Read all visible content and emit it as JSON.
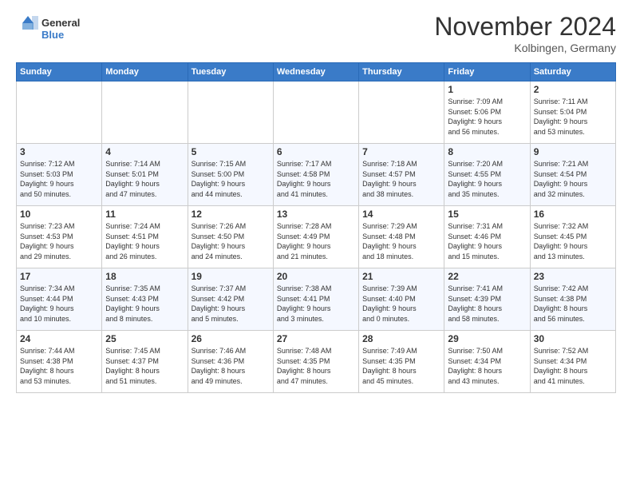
{
  "header": {
    "logo_general": "General",
    "logo_blue": "Blue",
    "month_title": "November 2024",
    "location": "Kolbingen, Germany"
  },
  "weekdays": [
    "Sunday",
    "Monday",
    "Tuesday",
    "Wednesday",
    "Thursday",
    "Friday",
    "Saturday"
  ],
  "weeks": [
    [
      {
        "day": "",
        "info": ""
      },
      {
        "day": "",
        "info": ""
      },
      {
        "day": "",
        "info": ""
      },
      {
        "day": "",
        "info": ""
      },
      {
        "day": "",
        "info": ""
      },
      {
        "day": "1",
        "info": "Sunrise: 7:09 AM\nSunset: 5:06 PM\nDaylight: 9 hours\nand 56 minutes."
      },
      {
        "day": "2",
        "info": "Sunrise: 7:11 AM\nSunset: 5:04 PM\nDaylight: 9 hours\nand 53 minutes."
      }
    ],
    [
      {
        "day": "3",
        "info": "Sunrise: 7:12 AM\nSunset: 5:03 PM\nDaylight: 9 hours\nand 50 minutes."
      },
      {
        "day": "4",
        "info": "Sunrise: 7:14 AM\nSunset: 5:01 PM\nDaylight: 9 hours\nand 47 minutes."
      },
      {
        "day": "5",
        "info": "Sunrise: 7:15 AM\nSunset: 5:00 PM\nDaylight: 9 hours\nand 44 minutes."
      },
      {
        "day": "6",
        "info": "Sunrise: 7:17 AM\nSunset: 4:58 PM\nDaylight: 9 hours\nand 41 minutes."
      },
      {
        "day": "7",
        "info": "Sunrise: 7:18 AM\nSunset: 4:57 PM\nDaylight: 9 hours\nand 38 minutes."
      },
      {
        "day": "8",
        "info": "Sunrise: 7:20 AM\nSunset: 4:55 PM\nDaylight: 9 hours\nand 35 minutes."
      },
      {
        "day": "9",
        "info": "Sunrise: 7:21 AM\nSunset: 4:54 PM\nDaylight: 9 hours\nand 32 minutes."
      }
    ],
    [
      {
        "day": "10",
        "info": "Sunrise: 7:23 AM\nSunset: 4:53 PM\nDaylight: 9 hours\nand 29 minutes."
      },
      {
        "day": "11",
        "info": "Sunrise: 7:24 AM\nSunset: 4:51 PM\nDaylight: 9 hours\nand 26 minutes."
      },
      {
        "day": "12",
        "info": "Sunrise: 7:26 AM\nSunset: 4:50 PM\nDaylight: 9 hours\nand 24 minutes."
      },
      {
        "day": "13",
        "info": "Sunrise: 7:28 AM\nSunset: 4:49 PM\nDaylight: 9 hours\nand 21 minutes."
      },
      {
        "day": "14",
        "info": "Sunrise: 7:29 AM\nSunset: 4:48 PM\nDaylight: 9 hours\nand 18 minutes."
      },
      {
        "day": "15",
        "info": "Sunrise: 7:31 AM\nSunset: 4:46 PM\nDaylight: 9 hours\nand 15 minutes."
      },
      {
        "day": "16",
        "info": "Sunrise: 7:32 AM\nSunset: 4:45 PM\nDaylight: 9 hours\nand 13 minutes."
      }
    ],
    [
      {
        "day": "17",
        "info": "Sunrise: 7:34 AM\nSunset: 4:44 PM\nDaylight: 9 hours\nand 10 minutes."
      },
      {
        "day": "18",
        "info": "Sunrise: 7:35 AM\nSunset: 4:43 PM\nDaylight: 9 hours\nand 8 minutes."
      },
      {
        "day": "19",
        "info": "Sunrise: 7:37 AM\nSunset: 4:42 PM\nDaylight: 9 hours\nand 5 minutes."
      },
      {
        "day": "20",
        "info": "Sunrise: 7:38 AM\nSunset: 4:41 PM\nDaylight: 9 hours\nand 3 minutes."
      },
      {
        "day": "21",
        "info": "Sunrise: 7:39 AM\nSunset: 4:40 PM\nDaylight: 9 hours\nand 0 minutes."
      },
      {
        "day": "22",
        "info": "Sunrise: 7:41 AM\nSunset: 4:39 PM\nDaylight: 8 hours\nand 58 minutes."
      },
      {
        "day": "23",
        "info": "Sunrise: 7:42 AM\nSunset: 4:38 PM\nDaylight: 8 hours\nand 56 minutes."
      }
    ],
    [
      {
        "day": "24",
        "info": "Sunrise: 7:44 AM\nSunset: 4:38 PM\nDaylight: 8 hours\nand 53 minutes."
      },
      {
        "day": "25",
        "info": "Sunrise: 7:45 AM\nSunset: 4:37 PM\nDaylight: 8 hours\nand 51 minutes."
      },
      {
        "day": "26",
        "info": "Sunrise: 7:46 AM\nSunset: 4:36 PM\nDaylight: 8 hours\nand 49 minutes."
      },
      {
        "day": "27",
        "info": "Sunrise: 7:48 AM\nSunset: 4:35 PM\nDaylight: 8 hours\nand 47 minutes."
      },
      {
        "day": "28",
        "info": "Sunrise: 7:49 AM\nSunset: 4:35 PM\nDaylight: 8 hours\nand 45 minutes."
      },
      {
        "day": "29",
        "info": "Sunrise: 7:50 AM\nSunset: 4:34 PM\nDaylight: 8 hours\nand 43 minutes."
      },
      {
        "day": "30",
        "info": "Sunrise: 7:52 AM\nSunset: 4:34 PM\nDaylight: 8 hours\nand 41 minutes."
      }
    ]
  ]
}
